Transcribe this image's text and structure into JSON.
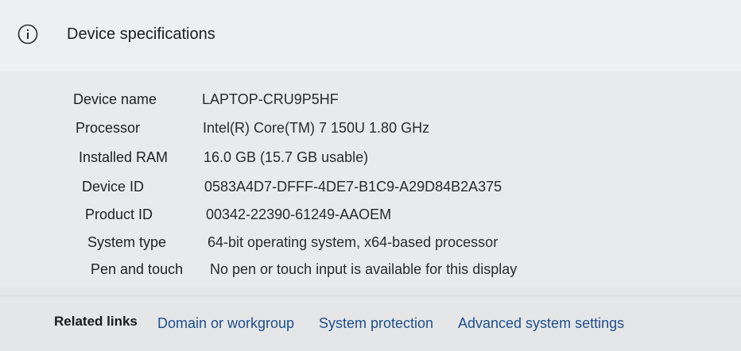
{
  "header": {
    "icon": "info-icon",
    "title": "Device specifications"
  },
  "specs": [
    {
      "label": "Device name",
      "value": "LAPTOP-CRU9P5HF"
    },
    {
      "label": "Processor",
      "value": "Intel(R) Core(TM) 7 150U   1.80 GHz"
    },
    {
      "label": "Installed RAM",
      "value": "16.0 GB (15.7 GB usable)"
    },
    {
      "label": "Device ID",
      "value": "0583A4D7-DFFF-4DE7-B1C9-A29D84B2A375"
    },
    {
      "label": "Product ID",
      "value": "00342-22390-61249-AAOEM"
    },
    {
      "label": "System type",
      "value": "64-bit operating system, x64-based processor"
    },
    {
      "label": "Pen and touch",
      "value": "No pen or touch input is available for this display"
    }
  ],
  "related": {
    "label": "Related links",
    "links": [
      "Domain or workgroup",
      "System protection",
      "Advanced system settings"
    ]
  },
  "colors": {
    "link": "#1f4f8a",
    "text": "#1f1f1f"
  }
}
